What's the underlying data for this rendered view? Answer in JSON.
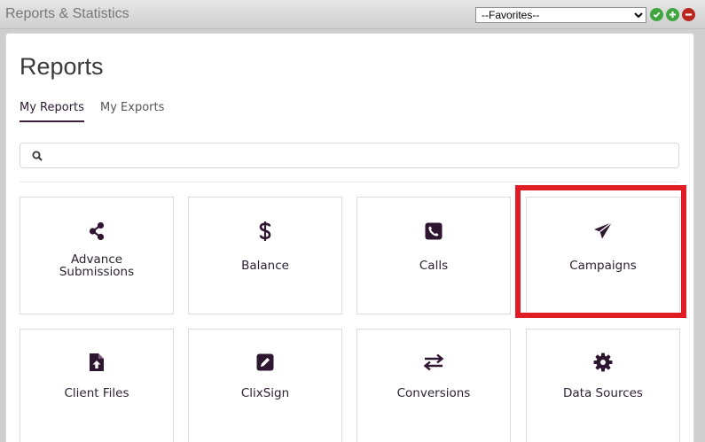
{
  "window": {
    "title": "Reports & Statistics",
    "favorites_select": {
      "value": "--Favorites--",
      "options": [
        "--Favorites--"
      ]
    }
  },
  "page": {
    "title": "Reports",
    "tabs": [
      {
        "label": "My Reports",
        "active": true
      },
      {
        "label": "My Exports",
        "active": false
      }
    ],
    "search": {
      "placeholder": "",
      "value": ""
    }
  },
  "reports": [
    {
      "label": "Advance\nSubmissions",
      "icon": "share-icon"
    },
    {
      "label": "Balance",
      "icon": "dollar-icon"
    },
    {
      "label": "Calls",
      "icon": "phone-square-icon"
    },
    {
      "label": "Campaigns",
      "icon": "paper-plane-icon",
      "highlighted": true
    },
    {
      "label": "Client Files",
      "icon": "file-upload-icon"
    },
    {
      "label": "ClixSign",
      "icon": "edit-square-icon"
    },
    {
      "label": "Conversions",
      "icon": "exchange-arrows-icon"
    },
    {
      "label": "Data Sources",
      "icon": "gear-icon"
    }
  ],
  "colors": {
    "icon": "#2e1530",
    "accent_tab": "#3b1f3b",
    "highlight_border": "#e01c24",
    "success_button": "#3fa53f",
    "danger_button": "#b8261d"
  }
}
